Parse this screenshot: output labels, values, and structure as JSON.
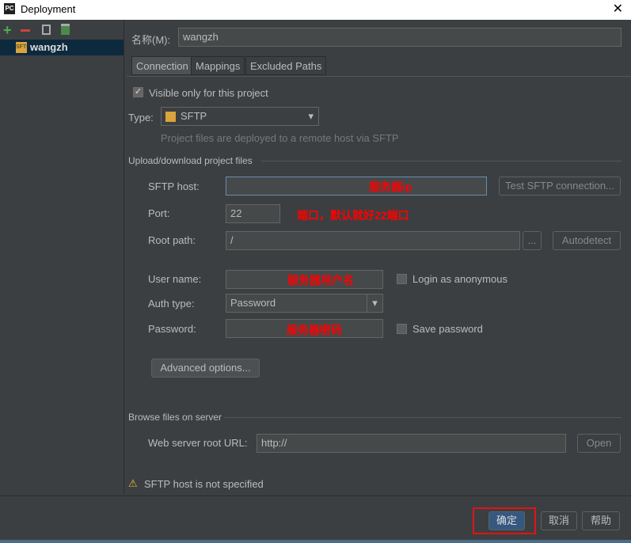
{
  "window": {
    "title": "Deployment",
    "logo": "PC",
    "close": "✕"
  },
  "sidebar": {
    "toolbar": [
      "add-icon",
      "remove-icon",
      "copy-icon",
      "default-icon"
    ],
    "items": [
      {
        "label": "wangzh",
        "type": "SFTP"
      }
    ]
  },
  "name": {
    "label": "名称(M):",
    "value": "wangzh"
  },
  "tabs": [
    "Connection",
    "Mappings",
    "Excluded Paths"
  ],
  "connection": {
    "visible_only": {
      "label": "Visible only for this project",
      "checked": true
    },
    "type": {
      "label": "Type:",
      "value": "SFTP",
      "hint": "Project files are deployed to a remote host via SFTP"
    },
    "upload_section": "Upload/download project files",
    "sftp_host": {
      "label": "SFTP host:",
      "value": "",
      "annotation": "服务器ip"
    },
    "test_button": "Test SFTP connection...",
    "port": {
      "label": "Port:",
      "value": "22",
      "annotation": "端口，默认就好22端口"
    },
    "root_path": {
      "label": "Root path:",
      "value": "/",
      "browse": "...",
      "autodetect": "Autodetect"
    },
    "user_name": {
      "label": "User name:",
      "value": "",
      "annotation": "服务器用户名"
    },
    "login_anonymous": {
      "label": "Login as anonymous",
      "checked": false
    },
    "auth_type": {
      "label": "Auth type:",
      "value": "Password"
    },
    "password": {
      "label": "Password:",
      "value": "",
      "annotation": "服务器密码"
    },
    "save_password": {
      "label": "Save password",
      "checked": false
    },
    "advanced": "Advanced options...",
    "browse_section": "Browse files on server",
    "web_root": {
      "label": "Web server root URL:",
      "value": "http://",
      "open": "Open"
    },
    "warning": "SFTP host is not specified"
  },
  "footer": {
    "ok": "确定",
    "cancel": "取消",
    "help": "帮助"
  },
  "colors": {
    "annotation": "#ff0000",
    "highlight": "#e0131a",
    "selection": "#0d293e"
  }
}
